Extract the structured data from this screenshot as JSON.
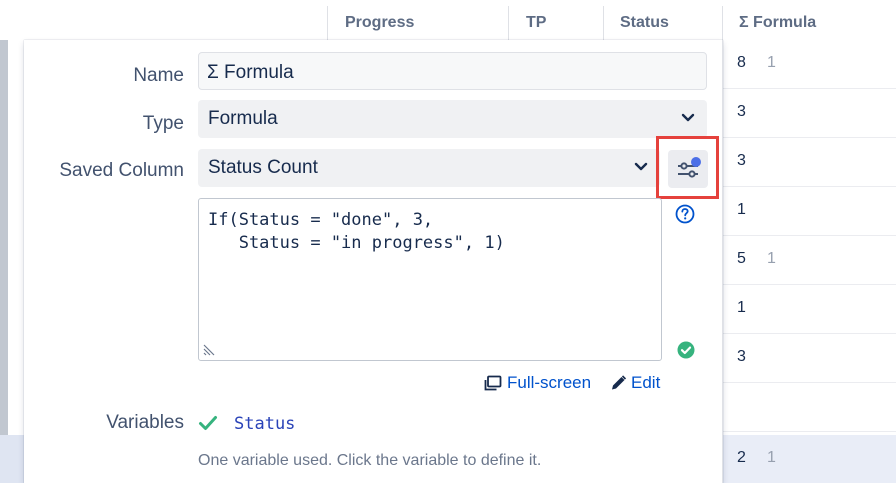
{
  "table": {
    "headers": {
      "progress": "Progress",
      "tp": "TP",
      "status": "Status",
      "formula": "Σ Formula"
    },
    "formula_rows": [
      {
        "value": "8",
        "sub": "1"
      },
      {
        "value": "3",
        "sub": ""
      },
      {
        "value": "3",
        "sub": ""
      },
      {
        "value": "1",
        "sub": ""
      },
      {
        "value": "5",
        "sub": "1"
      },
      {
        "value": "1",
        "sub": ""
      },
      {
        "value": "3",
        "sub": ""
      },
      {
        "value": "",
        "sub": ""
      },
      {
        "value": "2",
        "sub": "1"
      }
    ]
  },
  "panel": {
    "name_label": "Name",
    "name_value": "Σ Formula",
    "type_label": "Type",
    "type_value": "Formula",
    "saved_column_label": "Saved Column",
    "saved_column_value": "Status Count",
    "formula_lines": [
      "If(Status = \"done\", 3,",
      "   Status = \"in progress\", 1)"
    ],
    "fullscreen_label": "Full-screen",
    "edit_label": "Edit",
    "variables_label": "Variables",
    "variable_name": "Status",
    "variables_hint": "One variable used. Click the variable to define it."
  },
  "icons": {
    "chevron": "chevron-down-icon",
    "settings": "column-settings-icon",
    "help": "question-circle-icon",
    "valid": "check-circle-icon",
    "fullscreen": "fullscreen-icon",
    "edit": "pencil-icon",
    "variable_ok": "checkmark-icon"
  },
  "colors": {
    "accent_blue": "#0052cc",
    "highlight_red": "#e5413c",
    "success_green": "#36b37e",
    "settings_dot": "#4c6fe7"
  }
}
